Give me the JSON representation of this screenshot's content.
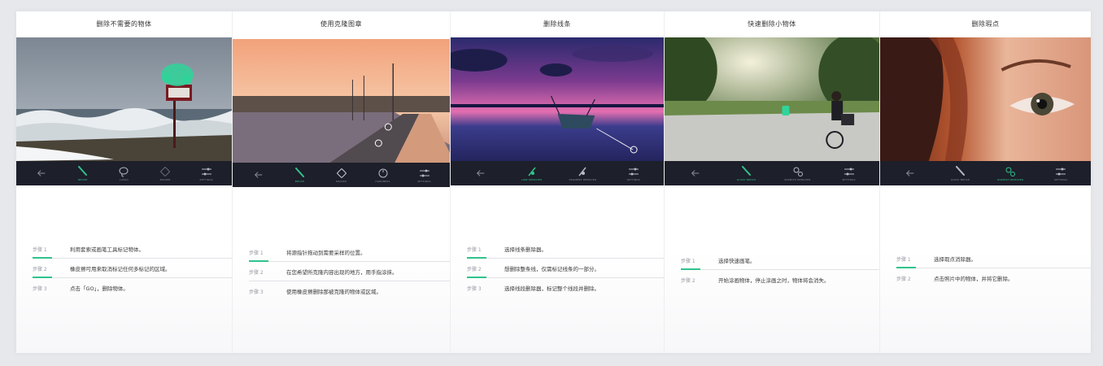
{
  "colors": {
    "accent": "#2fc48c",
    "toolbar": "#1d1f2a"
  },
  "panels": [
    {
      "title": "删除不需要的物体",
      "photo": "seascape-with-sign",
      "tools": [
        {
          "icon": "back-arrow-icon",
          "label": ""
        },
        {
          "icon": "brush-icon",
          "label": "BRUSH",
          "active": true
        },
        {
          "icon": "lasso-icon",
          "label": "LASSO"
        },
        {
          "icon": "eraser-icon",
          "label": "ERASER"
        },
        {
          "icon": "sliders-icon",
          "label": "SETTINGS"
        }
      ],
      "steps": [
        {
          "num": "步骤 1",
          "text": "利用套索或画笔工具标记物体。"
        },
        {
          "num": "步骤 2",
          "text": "橡皮擦可用来取消标记任何多标记的区域。"
        },
        {
          "num": "步骤 3",
          "text": "点击「GO」，删除物体。"
        }
      ]
    },
    {
      "title": "使用克隆图章",
      "photo": "harbor-pier-sunset",
      "tools": [
        {
          "icon": "back-arrow-icon",
          "label": ""
        },
        {
          "icon": "brush-icon",
          "label": "BRUSH",
          "active": true
        },
        {
          "icon": "eraser-icon",
          "label": "ERASER"
        },
        {
          "icon": "clone-icon",
          "label": "HARDNESS"
        },
        {
          "icon": "sliders-icon",
          "label": "SETTINGS"
        }
      ],
      "steps": [
        {
          "num": "步骤 1",
          "text": "将源指针拖动到需要采样的位置。"
        },
        {
          "num": "步骤 2",
          "text": "在您希望所克隆内容出现的地方，用手指涂抹。"
        },
        {
          "num": "步骤 3",
          "text": "使用橡皮擦删除那被克隆的物体或区域。"
        }
      ]
    },
    {
      "title": "删除线条",
      "photo": "boat-purple-sunset",
      "tools": [
        {
          "icon": "back-arrow-icon",
          "label": ""
        },
        {
          "icon": "line-remover-icon",
          "label": "LINE REMOVER",
          "active": true
        },
        {
          "icon": "segment-remover-icon",
          "label": "SEGMENT REMOVER"
        },
        {
          "icon": "sliders-icon",
          "label": "SETTINGS"
        }
      ],
      "steps": [
        {
          "num": "步骤 1",
          "text": "选择线条删除器。"
        },
        {
          "num": "步骤 2",
          "text": "想删除整条线，仅需标记线条的一部分。"
        },
        {
          "num": "步骤 3",
          "text": "选择线段删除器，标记整个线段并删除。"
        }
      ]
    },
    {
      "title": "快速删除小物体",
      "photo": "park-cyclist",
      "tools": [
        {
          "icon": "back-arrow-icon",
          "label": ""
        },
        {
          "icon": "quick-brush-icon",
          "label": "QUICK BRUSH",
          "active": true
        },
        {
          "icon": "blemish-remover-icon",
          "label": "BLEMISH REMOVER"
        },
        {
          "icon": "sliders-icon",
          "label": "SETTINGS"
        }
      ],
      "steps": [
        {
          "num": "步骤 1",
          "text": "选择快速画笔。"
        },
        {
          "num": "步骤 2",
          "text": "开始涂画物体，停止涂画之时，物体将会消失。"
        }
      ]
    },
    {
      "title": "删除瑕点",
      "photo": "woman-eye-closeup",
      "tools": [
        {
          "icon": "back-arrow-icon",
          "label": ""
        },
        {
          "icon": "quick-brush-icon",
          "label": "QUICK BRUSH"
        },
        {
          "icon": "blemish-remover-icon",
          "label": "BLEMISH REMOVER",
          "active": true
        },
        {
          "icon": "sliders-icon",
          "label": "SETTINGS"
        }
      ],
      "steps": [
        {
          "num": "步骤 1",
          "text": "选择瑕点消除器。"
        },
        {
          "num": "步骤 2",
          "text": "点击照片中的物体，并将它删除。"
        }
      ]
    }
  ]
}
